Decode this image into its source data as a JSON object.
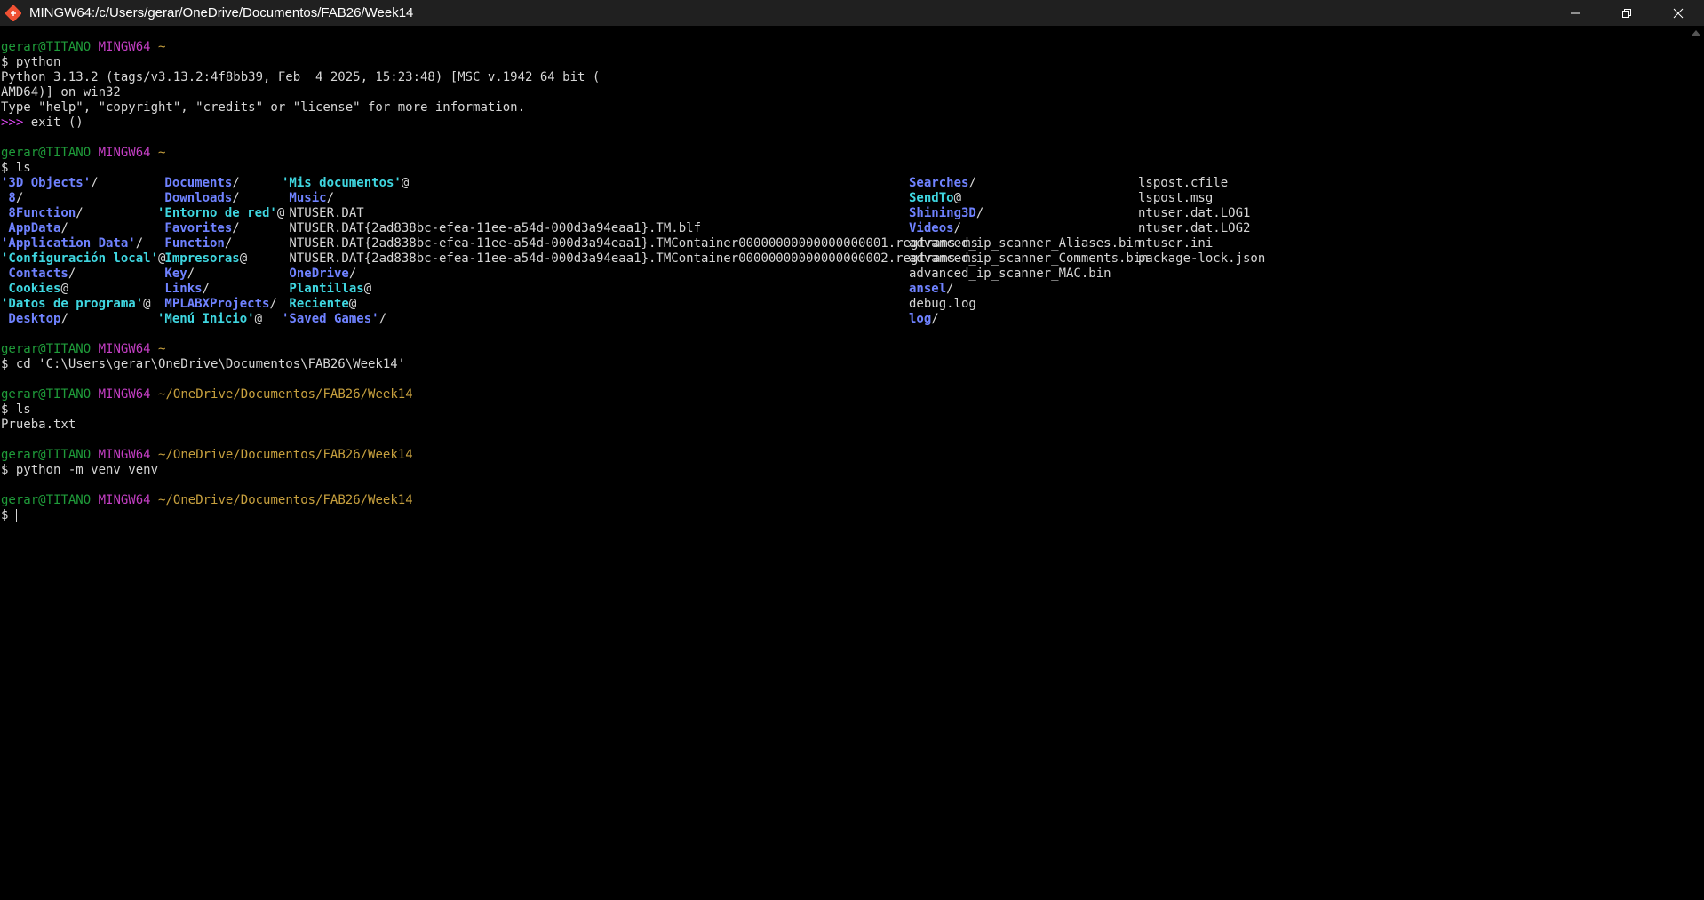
{
  "window": {
    "title": "MINGW64:/c/Users/gerar/OneDrive/Documentos/FAB26/Week14"
  },
  "prompt": {
    "user": "gerar@TITANO",
    "shell": "MINGW64",
    "home": "~",
    "cwd": "~/OneDrive/Documentos/FAB26/Week14"
  },
  "session1": {
    "cmd": "$ python",
    "out1": "Python 3.13.2 (tags/v3.13.2:4f8bb39, Feb  4 2025, 15:23:48) [MSC v.1942 64 bit (",
    "out2": "AMD64)] on win32",
    "out3": "Type \"help\", \"copyright\", \"credits\" or \"license\" for more information.",
    "repl_prompt": ">>>",
    "repl_cmd": " exit ()"
  },
  "session2": {
    "cmd": "$ ls",
    "col1": [
      {
        "t": "'3D Objects'",
        "k": "d",
        "s": "/"
      },
      {
        "t": " 8",
        "k": "d",
        "s": "/"
      },
      {
        "t": " 8Function",
        "k": "d",
        "s": "/"
      },
      {
        "t": " AppData",
        "k": "d",
        "s": "/"
      },
      {
        "t": "'Application Data'",
        "k": "d",
        "s": "/"
      },
      {
        "t": "'Configuración local'",
        "k": "c",
        "s": "@"
      },
      {
        "t": " Contacts",
        "k": "d",
        "s": "/"
      },
      {
        "t": " Cookies",
        "k": "c",
        "s": "@"
      },
      {
        "t": "'Datos de programa'",
        "k": "c",
        "s": "@"
      },
      {
        "t": " Desktop",
        "k": "d",
        "s": "/"
      }
    ],
    "col2": [
      {
        "t": " Documents",
        "k": "d",
        "s": "/"
      },
      {
        "t": " Downloads",
        "k": "d",
        "s": "/"
      },
      {
        "t": "'Entorno de red'",
        "k": "c",
        "s": "@"
      },
      {
        "t": " Favorites",
        "k": "d",
        "s": "/"
      },
      {
        "t": " Function",
        "k": "d",
        "s": "/"
      },
      {
        "t": " Impresoras",
        "k": "c",
        "s": "@"
      },
      {
        "t": " Key",
        "k": "d",
        "s": "/"
      },
      {
        "t": " Links",
        "k": "d",
        "s": "/"
      },
      {
        "t": " MPLABXProjects",
        "k": "d",
        "s": "/"
      },
      {
        "t": "'Menú Inicio'",
        "k": "c",
        "s": "@"
      }
    ],
    "col3": [
      {
        "t": "'Mis documentos'",
        "k": "c",
        "s": "@"
      },
      {
        "t": " Music",
        "k": "d",
        "s": "/"
      },
      {
        "t": " NTUSER.DAT",
        "k": "w",
        "s": ""
      },
      {
        "t": " NTUSER.DAT{2ad838bc-efea-11ee-a54d-000d3a94eaa1}.TM.blf",
        "k": "w",
        "s": ""
      },
      {
        "t": " NTUSER.DAT{2ad838bc-efea-11ee-a54d-000d3a94eaa1}.TMContainer00000000000000000001.regtrans-ms",
        "k": "w",
        "s": ""
      },
      {
        "t": " NTUSER.DAT{2ad838bc-efea-11ee-a54d-000d3a94eaa1}.TMContainer00000000000000000002.regtrans-ms",
        "k": "w",
        "s": ""
      },
      {
        "t": " OneDrive",
        "k": "d",
        "s": "/"
      },
      {
        "t": " Plantillas",
        "k": "c",
        "s": "@"
      },
      {
        "t": " Reciente",
        "k": "c",
        "s": "@"
      },
      {
        "t": "'Saved Games'",
        "k": "d",
        "s": "/"
      }
    ],
    "col4": [
      {
        "t": "Searches",
        "k": "d",
        "s": "/"
      },
      {
        "t": "SendTo",
        "k": "c",
        "s": "@"
      },
      {
        "t": "Shining3D",
        "k": "d",
        "s": "/"
      },
      {
        "t": "Videos",
        "k": "d",
        "s": "/"
      },
      {
        "t": "advanced_ip_scanner_Aliases.bin",
        "k": "w",
        "s": ""
      },
      {
        "t": "advanced_ip_scanner_Comments.bin",
        "k": "w",
        "s": ""
      },
      {
        "t": "advanced_ip_scanner_MAC.bin",
        "k": "w",
        "s": ""
      },
      {
        "t": "ansel",
        "k": "d",
        "s": "/"
      },
      {
        "t": "debug.log",
        "k": "w",
        "s": ""
      },
      {
        "t": "log",
        "k": "d",
        "s": "/"
      }
    ],
    "col5": [
      {
        "t": "lspost.cfile",
        "k": "w",
        "s": ""
      },
      {
        "t": "lspost.msg",
        "k": "w",
        "s": ""
      },
      {
        "t": "ntuser.dat.LOG1",
        "k": "w",
        "s": ""
      },
      {
        "t": "ntuser.dat.LOG2",
        "k": "w",
        "s": ""
      },
      {
        "t": "ntuser.ini",
        "k": "w",
        "s": ""
      },
      {
        "t": "package-lock.json",
        "k": "w",
        "s": ""
      }
    ]
  },
  "session3": {
    "cmd": "$ cd 'C:\\Users\\gerar\\OneDrive\\Documentos\\FAB26\\Week14'"
  },
  "session4": {
    "cmd": "$ ls",
    "out": "Prueba.txt"
  },
  "session5": {
    "cmd": "$ python -m venv venv"
  },
  "session6": {
    "cmd": "$ "
  },
  "colors": {
    "user": "#1f9c3a",
    "shell": "#c43fc4",
    "path": "#c7a03e",
    "dir": "#6f82ff",
    "link": "#3fd6e0"
  }
}
